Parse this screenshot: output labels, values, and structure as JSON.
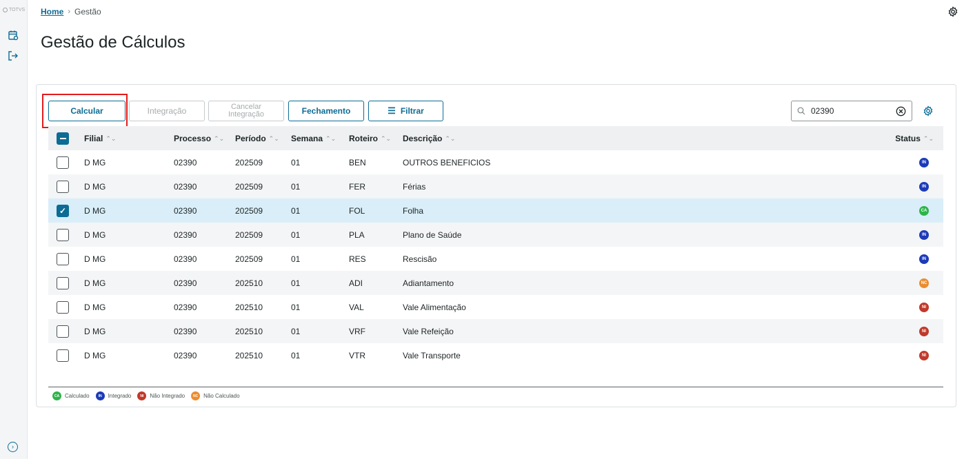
{
  "sidebar": {
    "logo_text": "TOTVS",
    "calendar_icon": "calendar-icon",
    "logout_icon": "logout-icon",
    "expand_icon": "chevron-right-circle-icon"
  },
  "breadcrumb": {
    "home": "Home",
    "current": "Gestão"
  },
  "page_title": "Gestão de Cálculos",
  "toolbar": {
    "calcular": "Calcular",
    "integracao": "Integração",
    "cancelar_l1": "Cancelar",
    "cancelar_l2": "Integração",
    "fechamento": "Fechamento",
    "filtrar": "Filtrar"
  },
  "search": {
    "value": "02390",
    "placeholder": ""
  },
  "table": {
    "headers": {
      "filial": "Filial",
      "processo": "Processo",
      "periodo": "Período",
      "semana": "Semana",
      "roteiro": "Roteiro",
      "descricao": "Descrição",
      "status": "Status"
    },
    "rows": [
      {
        "filial": "D MG",
        "processo": "02390",
        "periodo": "202509",
        "semana": "01",
        "roteiro": "BEN",
        "descricao": "OUTROS BENEFICIOS",
        "status": "IN",
        "checked": false
      },
      {
        "filial": "D MG",
        "processo": "02390",
        "periodo": "202509",
        "semana": "01",
        "roteiro": "FER",
        "descricao": "Férias",
        "status": "IN",
        "checked": false
      },
      {
        "filial": "D MG",
        "processo": "02390",
        "periodo": "202509",
        "semana": "01",
        "roteiro": "FOL",
        "descricao": "Folha",
        "status": "CA",
        "checked": true
      },
      {
        "filial": "D MG",
        "processo": "02390",
        "periodo": "202509",
        "semana": "01",
        "roteiro": "PLA",
        "descricao": "Plano de Saúde",
        "status": "IN",
        "checked": false
      },
      {
        "filial": "D MG",
        "processo": "02390",
        "periodo": "202509",
        "semana": "01",
        "roteiro": "RES",
        "descricao": "Rescisão",
        "status": "IN",
        "checked": false
      },
      {
        "filial": "D MG",
        "processo": "02390",
        "periodo": "202510",
        "semana": "01",
        "roteiro": "ADI",
        "descricao": "Adiantamento",
        "status": "NC",
        "checked": false
      },
      {
        "filial": "D MG",
        "processo": "02390",
        "periodo": "202510",
        "semana": "01",
        "roteiro": "VAL",
        "descricao": "Vale Alimentação",
        "status": "NI",
        "checked": false
      },
      {
        "filial": "D MG",
        "processo": "02390",
        "periodo": "202510",
        "semana": "01",
        "roteiro": "VRF",
        "descricao": "Vale Refeição",
        "status": "NI",
        "checked": false
      },
      {
        "filial": "D MG",
        "processo": "02390",
        "periodo": "202510",
        "semana": "01",
        "roteiro": "VTR",
        "descricao": "Vale Transporte",
        "status": "NI",
        "checked": false
      }
    ]
  },
  "legend": [
    {
      "code": "CA",
      "label": "Calculado",
      "color": "#2eb44a"
    },
    {
      "code": "IN",
      "label": "Integrado",
      "color": "#1c3bb8"
    },
    {
      "code": "NI",
      "label": "Não Integrado",
      "color": "#c0392b"
    },
    {
      "code": "NC",
      "label": "Não Calculado",
      "color": "#eb8c2e"
    }
  ],
  "status_colors": {
    "CA": "#2eb44a",
    "IN": "#1c3bb8",
    "NI": "#c0392b",
    "NC": "#eb8c2e"
  }
}
